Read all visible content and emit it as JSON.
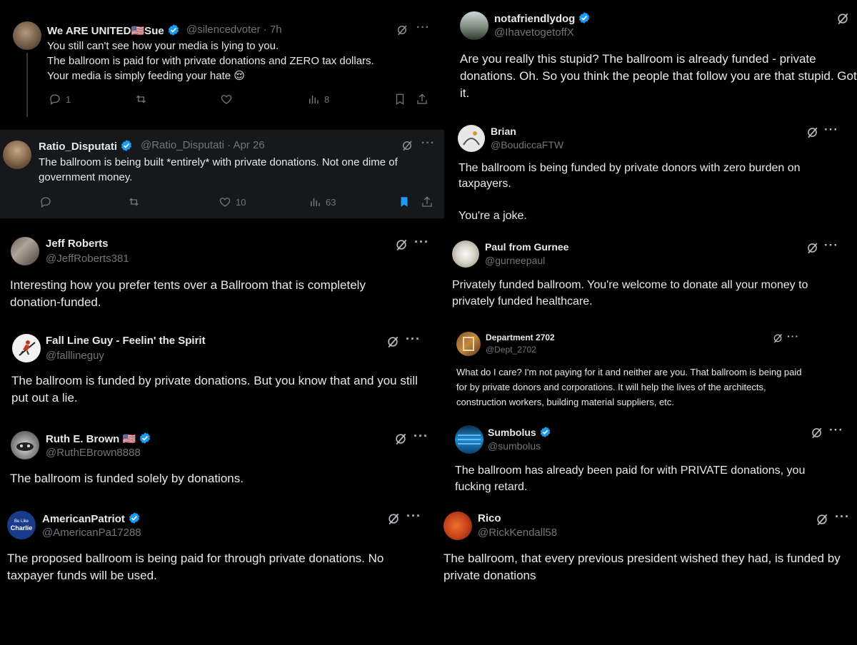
{
  "posts": [
    {
      "name": "We ARE UNITED🇺🇸Sue",
      "handle": "@silencedvoter",
      "time": "· 7h",
      "lines": [
        "You still can't see how your media is lying to you.",
        "The ballroom is paid for with private donations and ZERO tax dollars.",
        "Your media is simply feeding your hate 😌"
      ],
      "replies": "1",
      "views": "8"
    },
    {
      "name": "Ratio_Disputati",
      "handle": "@Ratio_Disputati",
      "time": "· Apr 26",
      "text": "The ballroom is being built *entirely* with private donations. Not one dime of government money.",
      "likes": "10",
      "views": "63"
    },
    {
      "name": "Jeff Roberts",
      "handle": "@JeffRoberts381",
      "text": "Interesting how you prefer tents over a Ballroom that is completely donation-funded."
    },
    {
      "name": "Fall Line Guy - Feelin' the Spirit",
      "handle": "@falllineguy",
      "text": "The ballroom is funded by private donations. But you know that and you still put out a lie."
    },
    {
      "name": "Ruth E. Brown 🇺🇸",
      "handle": "@RuthEBrown8888",
      "text": "The ballroom is funded solely by donations."
    },
    {
      "name": "AmericanPatriot",
      "handle": "@AmericanPa17288",
      "avatar_text": [
        "Be Like",
        "Charlie"
      ],
      "text": "The proposed ballroom is being paid for through private donations.  No taxpayer funds will be used."
    },
    {
      "name": "notafriendlydog",
      "handle": "@IhavetogetoffX",
      "text": "Are you really this stupid?  The ballroom is already funded - private donations.  Oh.  So you think the people that follow you are that stupid. Got it."
    },
    {
      "name": "Brian",
      "handle": "@BoudiccaFTW",
      "text": "The ballroom is being funded by private donors with zero burden on taxpayers.",
      "text2": "You're a joke."
    },
    {
      "name": "Paul from Gurnee",
      "handle": "@gurneepaul",
      "text": "Privately funded ballroom. You're welcome to donate all your money to privately funded healthcare."
    },
    {
      "name": "Department 2702",
      "handle": "@Dept_2702",
      "text": "What do I care? I'm not paying for it and neither are you. That ballroom is being paid for by private donors and corporations. It will help the lives of the architects, construction workers, building material suppliers, etc."
    },
    {
      "name": "Sumbolus",
      "handle": "@sumbolus",
      "text": "The ballroom has already been paid for with PRIVATE donations, you fucking retard."
    },
    {
      "name": "Rico",
      "handle": "@RickKendall58",
      "text": "The ballroom, that every previous president wished they had, is funded by private donations"
    }
  ],
  "icons": {
    "more": "more-icon",
    "grok": "grok-icon",
    "verified": "verified-badge-icon"
  },
  "colors": {
    "background": "#000000",
    "text": "#e7e9ea",
    "secondary": "#71767b",
    "verified": "#1d9bf0",
    "highlight_panel": "#16181c"
  }
}
